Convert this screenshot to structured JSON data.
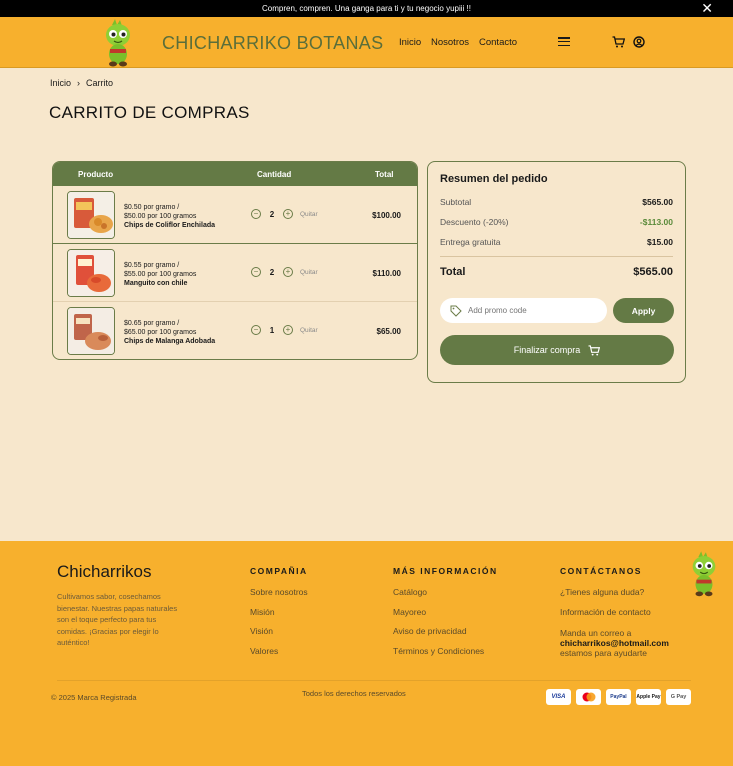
{
  "announcement": {
    "text": "Compren, compren. Una ganga para ti y tu negocio yupiii !!"
  },
  "header": {
    "brand": "CHICHARRIKO BOTANAS",
    "nav": [
      "Inicio",
      "Nosotros",
      "Contacto"
    ]
  },
  "breadcrumb": {
    "home": "Inicio",
    "current": "Carrito"
  },
  "page_title": "CARRITO DE COMPRAS",
  "cart": {
    "headers": {
      "product": "Producto",
      "quantity": "Cantidad",
      "total": "Total"
    },
    "remove_label": "Quitar",
    "items": [
      {
        "price_line1": "$0.50 por gramo /",
        "price_line2": "$50.00 por 100 gramos",
        "name": "Chips de Coliflor Enchilada",
        "qty": "2",
        "total": "$100.00"
      },
      {
        "price_line1": "$0.55 por gramo /",
        "price_line2": "$55.00 por 100 gramos",
        "name": "Manguito con chile",
        "qty": "2",
        "total": "$110.00"
      },
      {
        "price_line1": "$0.65 por gramo /",
        "price_line2": "$65.00 por 100 gramos",
        "name": "Chips de Malanga Adobada",
        "qty": "1",
        "total": "$65.00"
      }
    ]
  },
  "summary": {
    "title": "Resumen del pedido",
    "subtotal_label": "Subtotal",
    "subtotal": "$565.00",
    "discount_label": "Descuento (-20%)",
    "discount": "-$113.00",
    "delivery_label": "Entrega gratuita",
    "delivery": "$15.00",
    "total_label": "Total",
    "total": "$565.00",
    "promo_placeholder": "Add promo code",
    "apply_label": "Apply",
    "checkout_label": "Finalizar compra"
  },
  "footer": {
    "brand": "Chicharrikos",
    "description": "Cultivamos sabor, cosechamos bienestar. Nuestras papas naturales son el toque perfecto para tus comidas. ¡Gracias por elegir lo auténtico!",
    "company": {
      "title": "COMPAÑIA",
      "links": [
        "Sobre nosotros",
        "Misión",
        "Visión",
        "Valores"
      ]
    },
    "more_info": {
      "title": "MÁS INFORMACIÓN",
      "links": [
        "Catálogo",
        "Mayoreo",
        "Aviso de privacidad",
        "Términos y Condiciones"
      ]
    },
    "contact": {
      "title": "CONTÁCTANOS",
      "links": [
        "¿Tienes alguna duda?",
        "Información de contacto"
      ],
      "mail_prefix": "Manda un correo a",
      "email": "chicharrikos@hotmail.com",
      "mail_suffix": "estamos para ayudarte"
    },
    "copyright": "© 2025 Marca Registrada",
    "rights": "Todos los derechos reservados",
    "payments": [
      "VISA",
      "Mastercard",
      "PayPal",
      "Apple Pay",
      "G Pay"
    ]
  },
  "colors": {
    "brand_yellow": "#f7b02d",
    "brand_green": "#647a45",
    "background": "#f7e7cc"
  }
}
